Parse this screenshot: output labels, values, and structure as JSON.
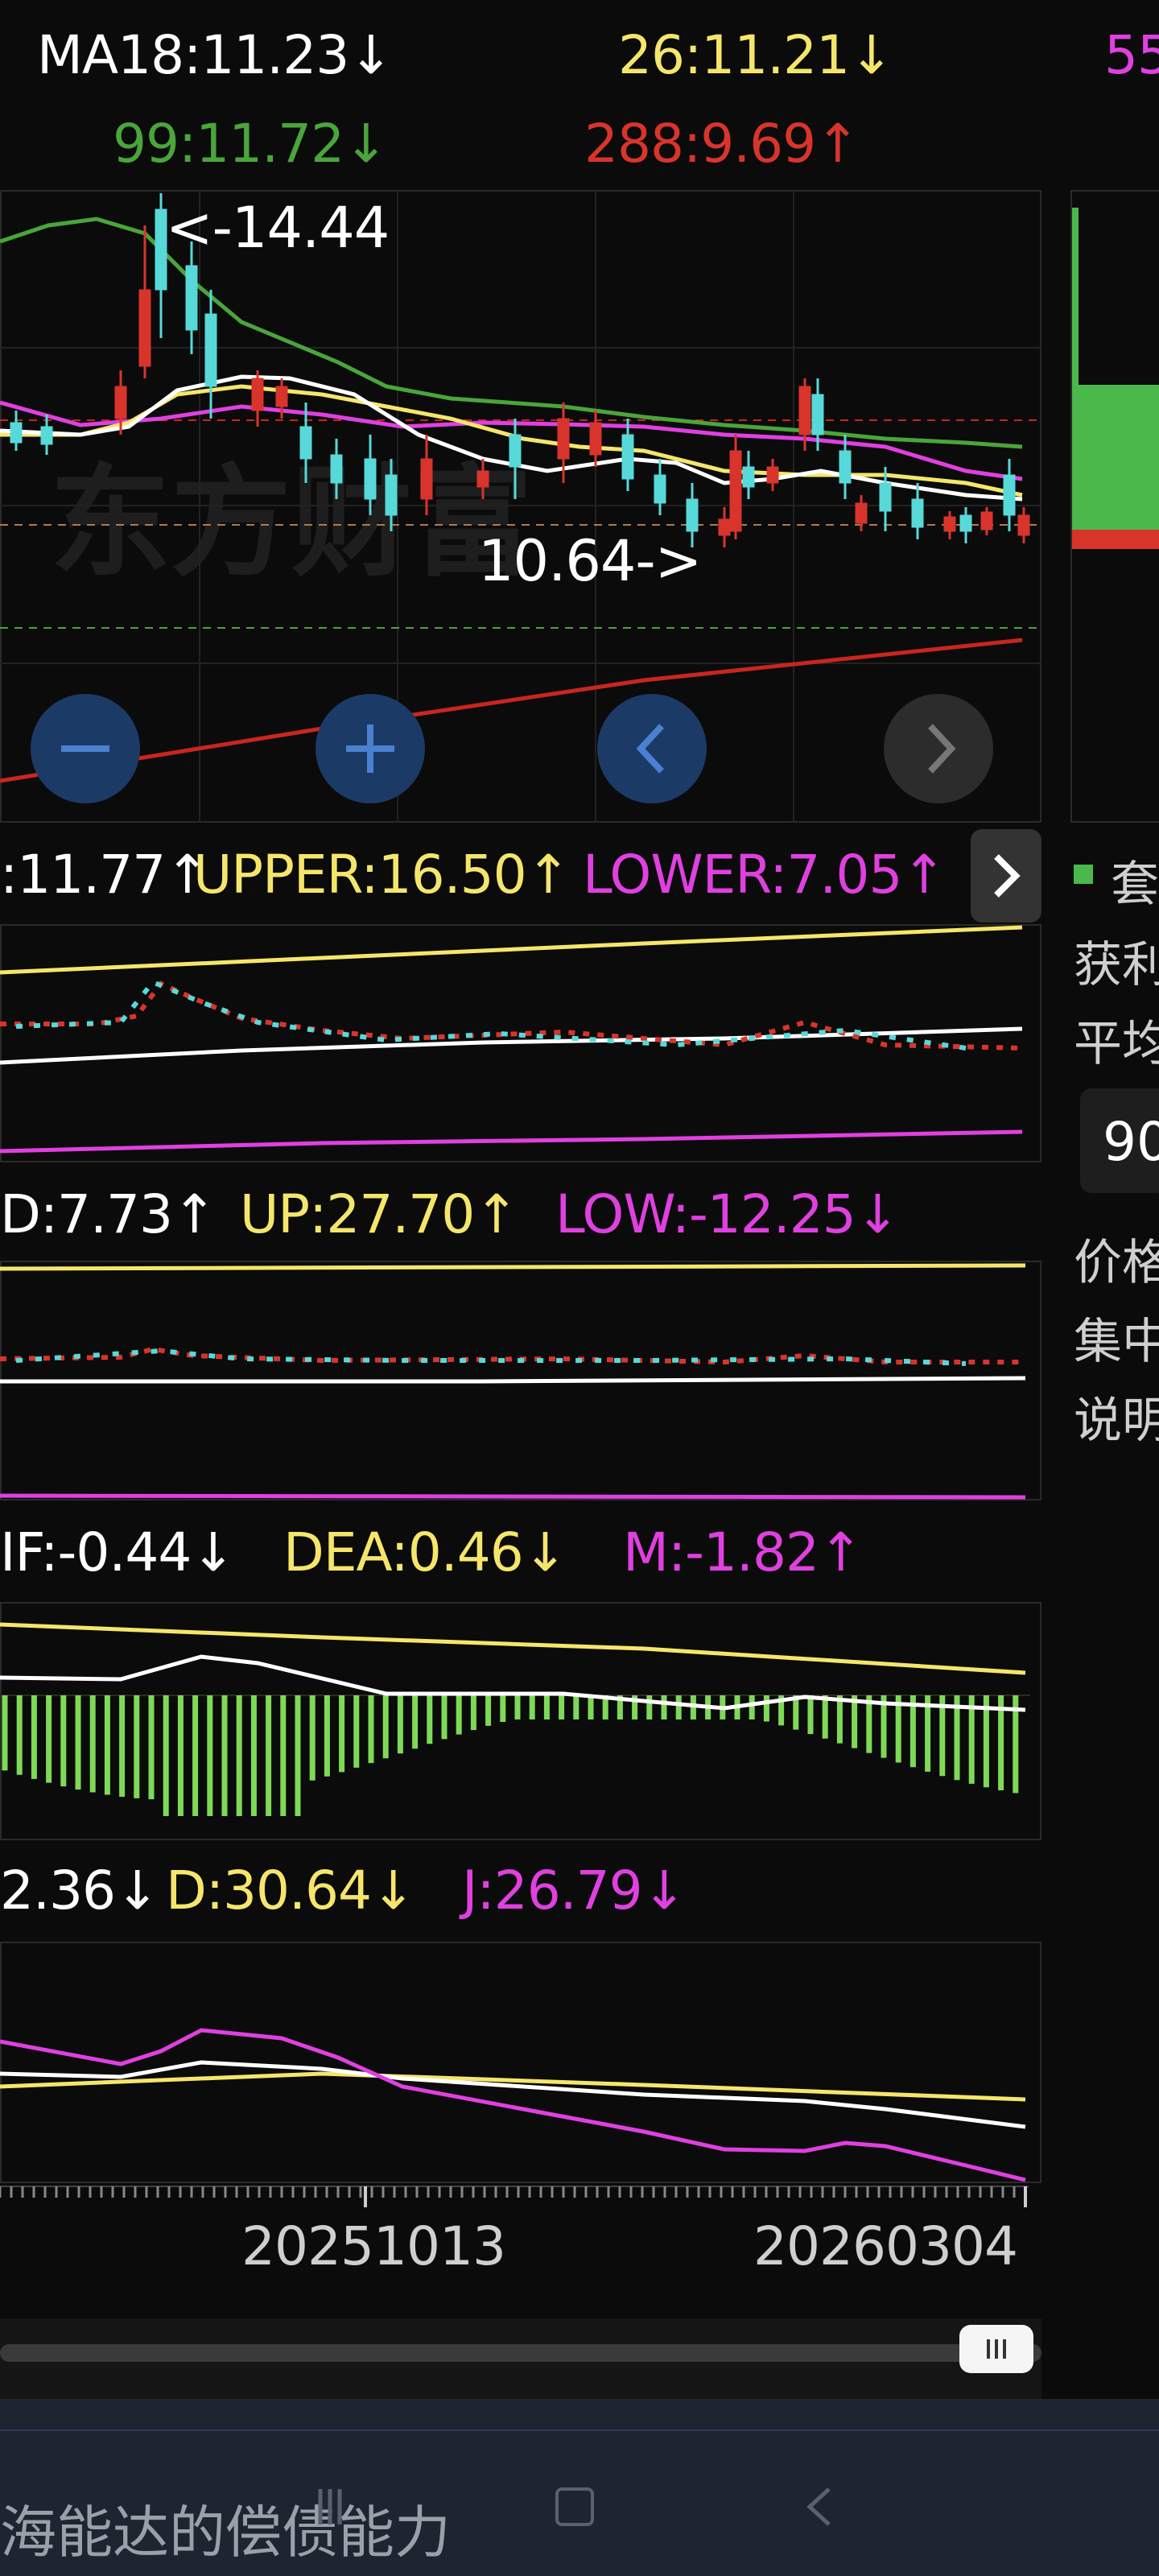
{
  "ma_legend": {
    "ma18": "MA18:11.23↓",
    "ma26": "26:11.21↓",
    "ma_cut": "55",
    "ma99": "99:11.72↓",
    "ma288": "288:9.69↑"
  },
  "main_chart": {
    "high_label": "<-14.44",
    "low_label": "10.64->",
    "watermark": "东方财富"
  },
  "boll": {
    "mid": ":11.77↑",
    "upper": "UPPER:16.50↑",
    "lower": "LOWER:7.05↑"
  },
  "env": {
    "mid": "D:7.73↑",
    "up": "UP:27.70↑",
    "low": "LOW:-12.25↓"
  },
  "macd": {
    "dif": "IF:-0.44↓",
    "dea": "DEA:0.46↓",
    "m": "M:-1.82↑"
  },
  "kdj": {
    "k": "2.36↓",
    "d": "D:30.64↓",
    "j": "J:26.79↓"
  },
  "x_axis": {
    "dates": [
      "20251013",
      "20260304"
    ]
  },
  "sidebar": {
    "legend_label": "套",
    "row1": "获利",
    "row2": "平均",
    "input_value": "90",
    "row3": "价格",
    "row4": "集中",
    "row5": "说明"
  },
  "bottom": {
    "ticker_text": "海能达的偿债能力",
    "scroll_handle_icon": "grip-lines-icon"
  },
  "colors": {
    "up": "#d9342b",
    "down": "#57d9d9",
    "ma_white": "#ffffff",
    "ma_yellow": "#f5e66b",
    "ma_magenta": "#e040e0",
    "ma_green": "#4aa53a",
    "ma_red": "#c8261f",
    "macd_bar": "#7ed957",
    "button_blue": "#1c3a66",
    "button_gray": "#2c2c2c"
  }
}
